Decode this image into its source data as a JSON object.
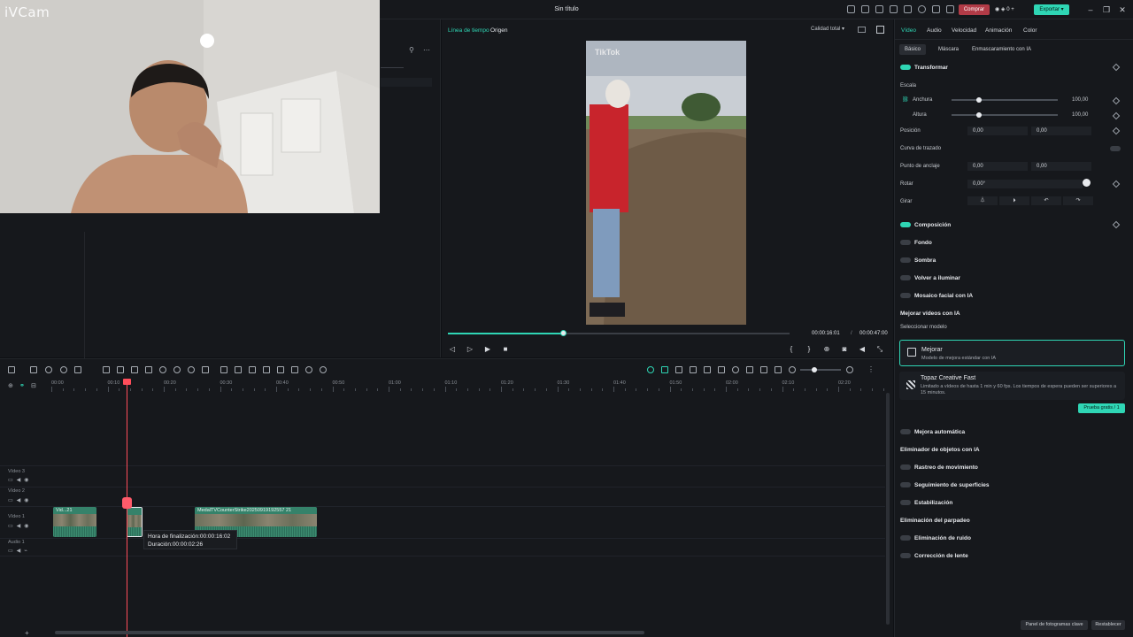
{
  "window": {
    "title": "Sin título",
    "buy_label": "Comprar",
    "credits": "0",
    "export_label": "Exportar",
    "colors": {
      "accent": "#2fd6b5",
      "buy": "#b23b47",
      "playhead": "#ff4d5a"
    }
  },
  "webcam": {
    "label": "iVCam"
  },
  "preview": {
    "tabs": [
      "Línea de tiempo",
      "Origen"
    ],
    "quality": "Calidad total",
    "video_watermark": "TikTok",
    "current_time": "00:00:16:01",
    "separator": "/",
    "total_time": "00:00:47:00",
    "progress": 0.34
  },
  "props": {
    "tabs": [
      "Vídeo",
      "Audio",
      "Velocidad",
      "Animación",
      "Color"
    ],
    "subtabs": [
      "Básico",
      "Máscara",
      "Enmascaramiento con IA"
    ],
    "transform": {
      "title": "Transformar",
      "scale_label": "Escala",
      "width_label": "Anchura",
      "width_value": "100,00",
      "height_label": "Altura",
      "height_value": "100,00",
      "position_label": "Posición",
      "pos_x": "0,00",
      "pos_y": "0,00",
      "curve_label": "Curva de trazado",
      "anchor_label": "Punto de anclaje",
      "anchor_x": "0,00",
      "anchor_y": "0,00",
      "rotate_label": "Rotar",
      "rotate_value": "0,00°",
      "flip_label": "Girar"
    },
    "sections": {
      "composition": "Composición",
      "background": "Fondo",
      "shadow": "Sombra",
      "relight": "Volver a iluminar",
      "face_mosaic": "Mosaico facial con IA",
      "enhance": "Mejorar vídeos con IA",
      "select_model": "Seleccionar modelo",
      "auto_enhance": "Mejora automática",
      "object_remover": "Eliminador de objetos con IA",
      "motion_tracking": "Rastreo de movimiento",
      "surface_tracking": "Seguimiento de superficies",
      "stabilization": "Estabilización",
      "flicker": "Eliminación del parpadeo",
      "denoise": "Eliminación de ruido",
      "lens": "Corrección de lente"
    },
    "model_mejorar": {
      "title": "Mejorar",
      "desc": "Modelo de mejora estándar con IA"
    },
    "model_topaz": {
      "title": "Topaz Creative Fast",
      "desc": "Limitado a vídeos de hasta 1 min y 60 fps. Los tiempos de espera pueden ser superiores a 15 minutos."
    },
    "try_free": "Prueba gratis / 1",
    "keyframe_panel": "Panel de fotogramas clave",
    "reset": "Restablecer"
  },
  "timeline": {
    "ruler": [
      "00:00",
      "00:10",
      "00:20",
      "00:30",
      "00:40",
      "00:50",
      "01:00",
      "01:10",
      "01:20",
      "01:30",
      "01:40",
      "01:50",
      "02:00",
      "02:10",
      "02:20"
    ],
    "tracks": [
      "Vídeo 3",
      "Vídeo 2",
      "Vídeo 1",
      "Audio 1"
    ],
    "clips": [
      {
        "label": "Vid...21"
      },
      {
        "label": ""
      },
      {
        "label": "MedalTVCounterStrike20250919192557 21"
      }
    ],
    "tooltip_end": "Hora de finalización:00:00:16:02",
    "tooltip_duration": "Duración:00:00:02:26"
  }
}
